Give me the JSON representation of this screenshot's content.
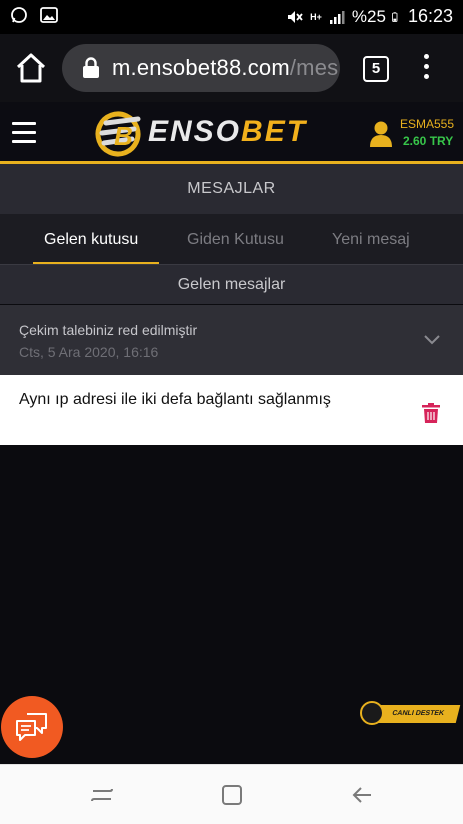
{
  "status_bar": {
    "battery_percent": "%25",
    "time": "16:23",
    "network": "H+"
  },
  "browser": {
    "url_host": "m.ensobet88.com",
    "url_path": "/mes",
    "tab_count": "5"
  },
  "site": {
    "logo_text_a": "ENSO",
    "logo_text_b": "BET",
    "username": "ESMA555",
    "balance": "2.60 TRY"
  },
  "page": {
    "section_title": "MESAJLAR",
    "tabs": [
      {
        "label": "Gelen kutusu",
        "active": true
      },
      {
        "label": "Giden Kutusu",
        "active": false
      },
      {
        "label": "Yeni mesaj",
        "active": false
      }
    ],
    "sub_title": "Gelen mesajlar"
  },
  "messages": [
    {
      "subject": "Çekim talebiniz red edilmiştir",
      "date": "Cts, 5 Ara 2020, 16:16",
      "body": "Aynı ıp adresi ile iki defa bağlantı sağlanmış"
    }
  ],
  "widgets": {
    "live_support_label": "CANLI DESTEK"
  },
  "colors": {
    "accent": "#e8b11e",
    "balance": "#38c64a",
    "chat_fab": "#f15a22",
    "delete": "#d6245a"
  }
}
